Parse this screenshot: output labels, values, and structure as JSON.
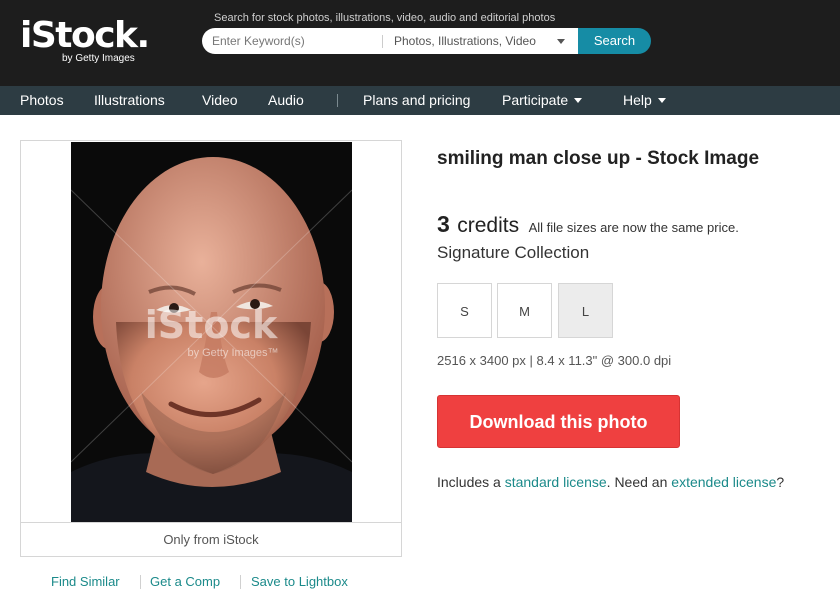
{
  "brand": {
    "logo": "iStock.",
    "tagline": "by Getty Images"
  },
  "search": {
    "caption": "Search for stock photos, illustrations, video, audio and editorial photos",
    "placeholder": "Enter Keyword(s)",
    "type_selected": "Photos, Illustrations, Video",
    "button_label": "Search"
  },
  "nav": {
    "photos": "Photos",
    "illustrations": "Illustrations",
    "video": "Video",
    "audio": "Audio",
    "plans": "Plans and pricing",
    "participate": "Participate",
    "help": "Help"
  },
  "image": {
    "watermark_main": "iStock",
    "watermark_sub": "by Getty Images™",
    "only_from": "Only from iStock",
    "links": {
      "find_similar": "Find Similar",
      "get_comp": "Get a Comp",
      "save_lightbox": "Save to Lightbox"
    }
  },
  "details": {
    "title": "smiling man close up - Stock Image",
    "credits_number": "3",
    "credits_word": "credits",
    "credits_note": "All file sizes are now the same price.",
    "collection": "Signature Collection",
    "sizes": [
      "S",
      "M",
      "L"
    ],
    "selected_size": "L",
    "dimensions": "2516 x 3400 px | 8.4 x 11.3\" @ 300.0 dpi",
    "download_label": "Download this photo",
    "license": {
      "prefix": "Includes a ",
      "standard": "standard license",
      "middle": ". Need an ",
      "extended": "extended license",
      "suffix": "?"
    }
  },
  "colors": {
    "header_bg": "#1d1d1d",
    "nav_bg": "#2d3c43",
    "accent_teal": "#168ca5",
    "link_teal": "#1b8a8a",
    "download_red": "#ef4040"
  }
}
